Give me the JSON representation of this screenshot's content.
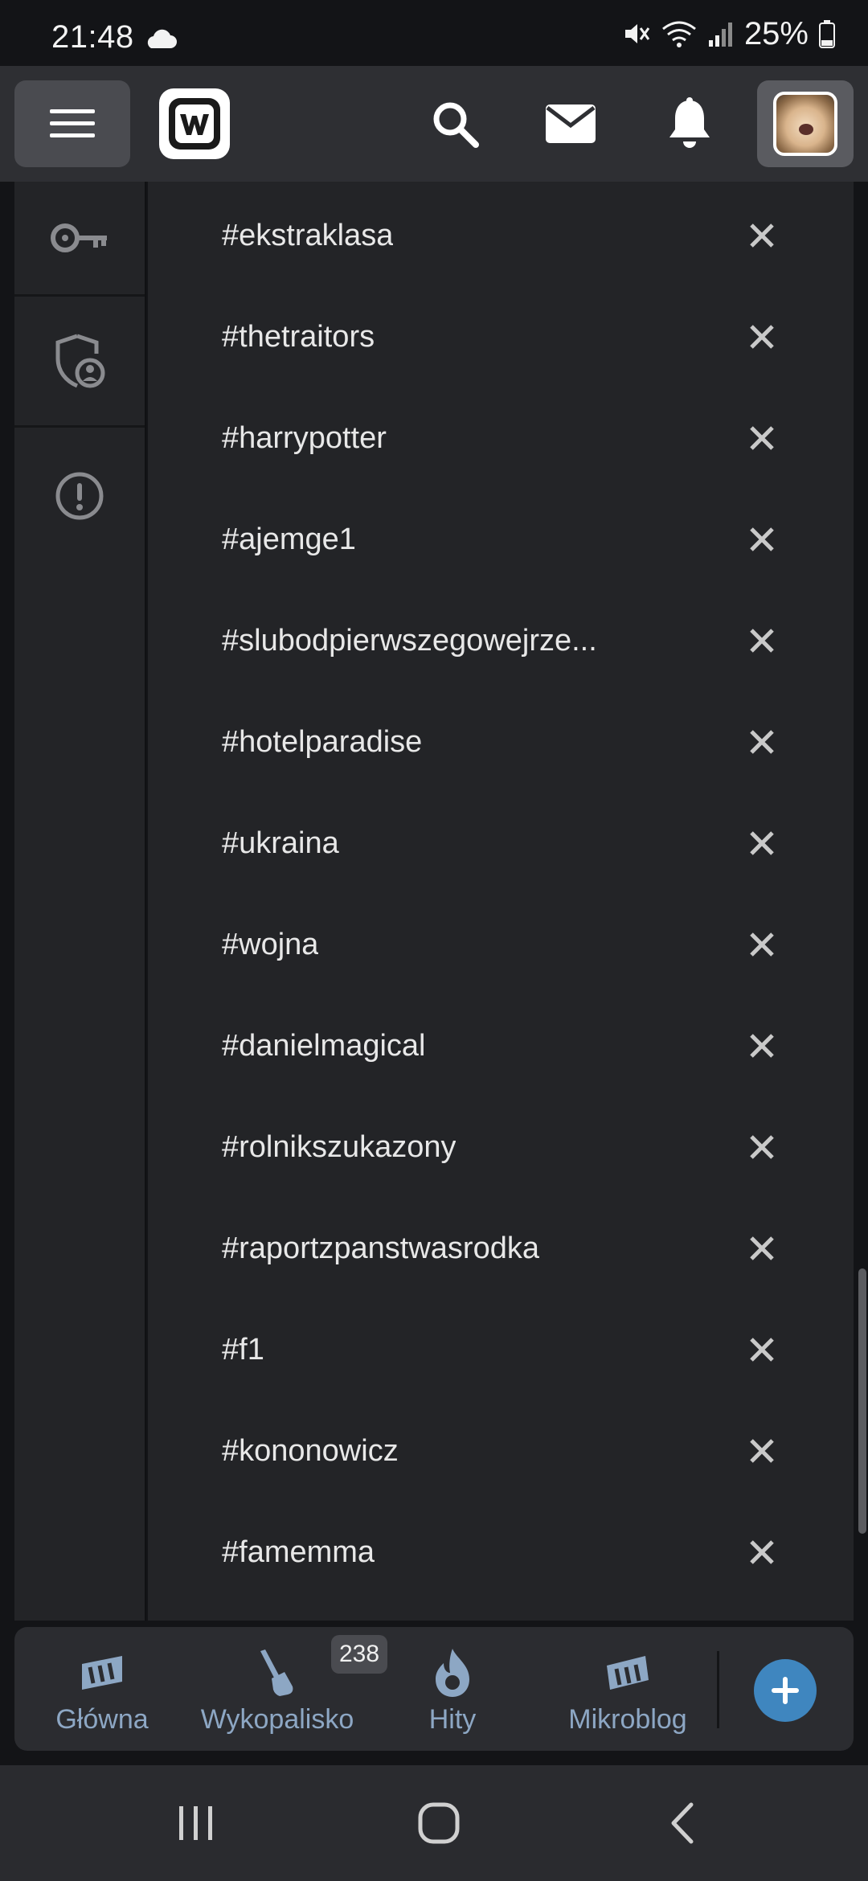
{
  "status_bar": {
    "time": "21:48",
    "battery": "25%"
  },
  "app_bar": {
    "menu_icon": "hamburger-icon",
    "logo": "wykop-logo",
    "icons": [
      "search-icon",
      "mail-icon",
      "bell-icon"
    ],
    "avatar": "user-avatar"
  },
  "rail": {
    "items": [
      "key-icon",
      "shield-user-icon",
      "alert-circle-icon"
    ]
  },
  "tags": [
    {
      "label": "#ekstraklasa"
    },
    {
      "label": "#thetraitors"
    },
    {
      "label": "#harrypotter"
    },
    {
      "label": "#ajemge1"
    },
    {
      "label": "#slubodpierwszegowejrze..."
    },
    {
      "label": "#hotelparadise"
    },
    {
      "label": "#ukraina"
    },
    {
      "label": "#wojna"
    },
    {
      "label": "#danielmagical"
    },
    {
      "label": "#rolnikszukazony"
    },
    {
      "label": "#raportzpanstwasrodka"
    },
    {
      "label": "#f1"
    },
    {
      "label": "#kononowicz"
    },
    {
      "label": "#famemma"
    }
  ],
  "bottom_nav": {
    "items": [
      {
        "label": "Główna",
        "icon": "home-icon"
      },
      {
        "label": "Wykopalisko",
        "icon": "shovel-icon",
        "badge": "238"
      },
      {
        "label": "Hity",
        "icon": "flame-icon"
      },
      {
        "label": "Mikroblog",
        "icon": "mikroblog-icon"
      }
    ],
    "fab_icon": "plus-icon"
  },
  "colors": {
    "background": "#131417",
    "header": "#2e2f33",
    "panel": "#232427",
    "nav_label": "#8da7c4",
    "fab": "#3f86bf"
  }
}
